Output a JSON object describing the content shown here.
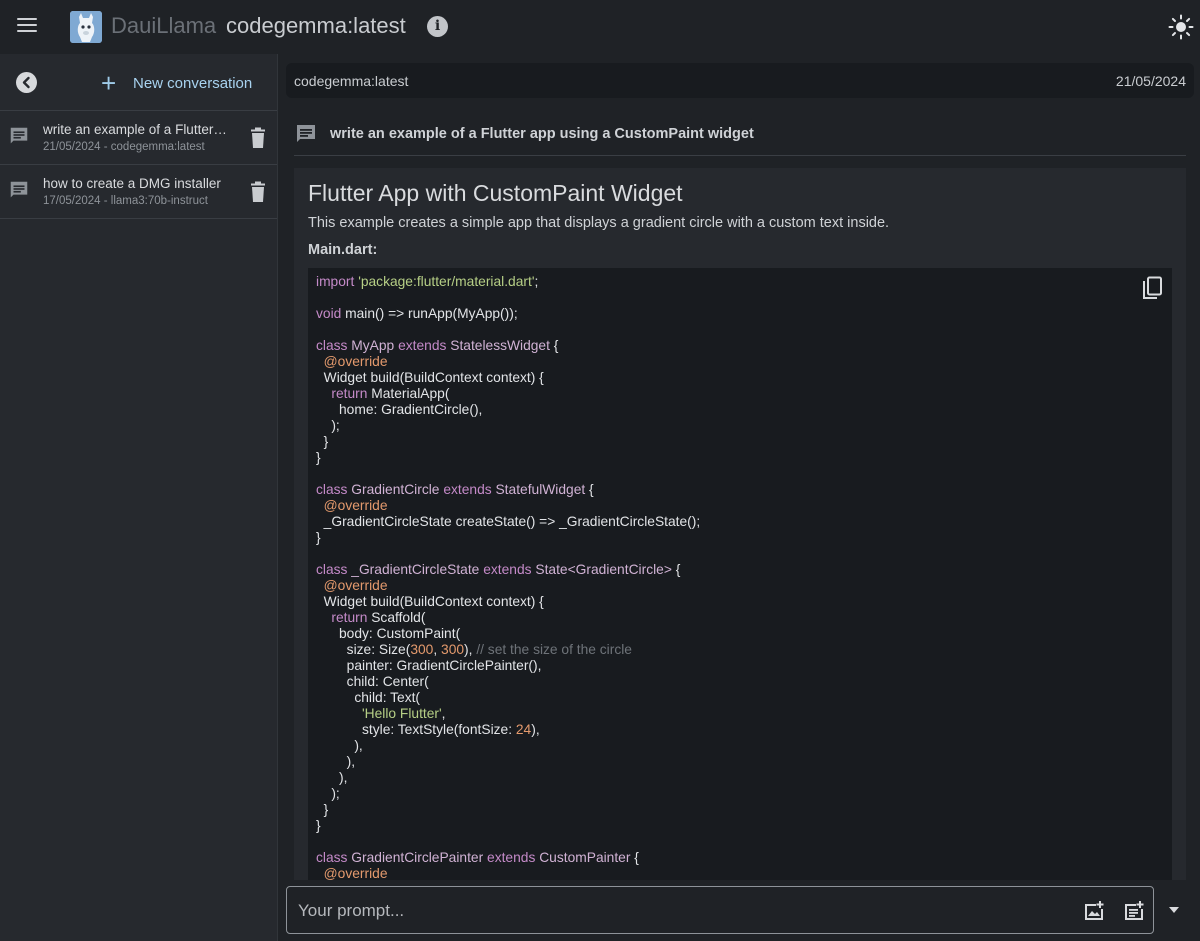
{
  "app": {
    "brand": "DauiLlama",
    "model": "codegemma:latest"
  },
  "sidebar": {
    "new_conversation_label": "New conversation",
    "items": [
      {
        "title": "write an example of a Flutter app using a CustomPaint widget",
        "meta": "21/05/2024 - codegemma:latest"
      },
      {
        "title": "how to create a DMG installer",
        "meta": "17/05/2024 - llama3:70b-instruct"
      }
    ]
  },
  "conversation": {
    "model": "codegemma:latest",
    "date": "21/05/2024",
    "user_message": "write an example of a Flutter app using a CustomPaint widget",
    "answer": {
      "heading": "Flutter App with CustomPaint Widget",
      "description": "This example creates a simple app that displays a gradient circle with a custom text inside.",
      "file_label": "Main.dart:"
    }
  },
  "prompt": {
    "placeholder": "Your prompt...",
    "value": ""
  },
  "icons": {
    "menu": "menu-icon",
    "info": "info-icon",
    "theme": "sun-icon",
    "back": "chevron-left-icon",
    "new": "plus-icon",
    "chat": "chat-bubble-icon",
    "delete": "trash-icon",
    "copy": "copy-icon",
    "add_image": "add-image-icon",
    "add_document": "add-document-icon",
    "dropdown": "caret-down-icon"
  },
  "colors": {
    "background": "#1f2226",
    "sidebar": "#26292e",
    "code_background": "#181b1f",
    "accent": "#a8d2ef",
    "keyword": "#c48ac8",
    "string": "#b6cf86",
    "number": "#e49a6d"
  }
}
